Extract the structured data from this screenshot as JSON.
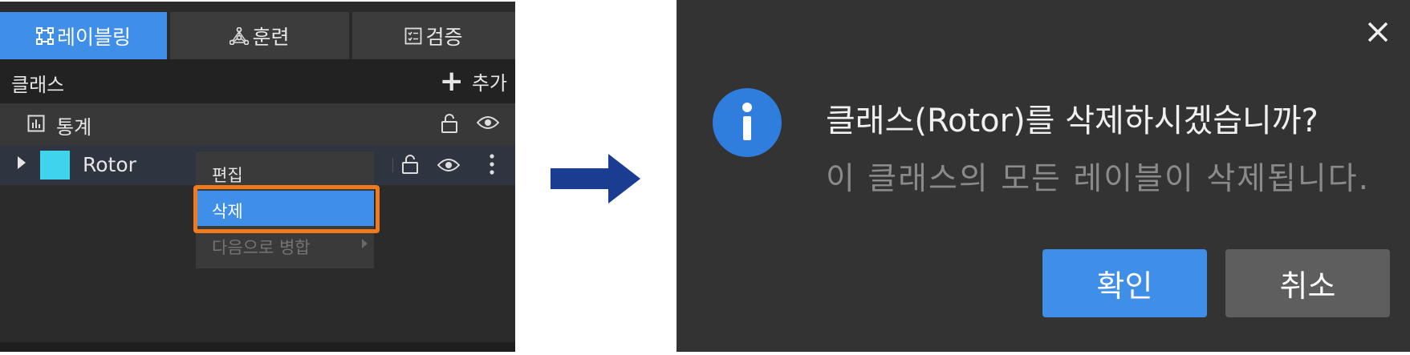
{
  "panel": {
    "tabs": [
      {
        "label": "레이블링",
        "icon": "bounding-box-icon",
        "active": true
      },
      {
        "label": "훈련",
        "icon": "network-icon",
        "active": false
      },
      {
        "label": "검증",
        "icon": "list-check-icon",
        "active": false
      }
    ],
    "class_header": {
      "title": "클래스",
      "add_label": "추가"
    },
    "stats_row": {
      "label": "통계"
    },
    "rotor_row": {
      "name": "Rotor",
      "color": "#3ed4ee"
    },
    "context_menu": {
      "edit": "편집",
      "delete": "삭제",
      "merge": "다음으로 병합"
    }
  },
  "dialog": {
    "question": "클래스(Rotor)를 삭제하시겠습니까?",
    "message": "이 클래스의 모든 레이블이 삭제됩니다.",
    "confirm_label": "확인",
    "cancel_label": "취소"
  },
  "colors": {
    "accent": "#3f8ee7",
    "highlight": "#f07b1e",
    "arrow": "#1a3d91"
  }
}
